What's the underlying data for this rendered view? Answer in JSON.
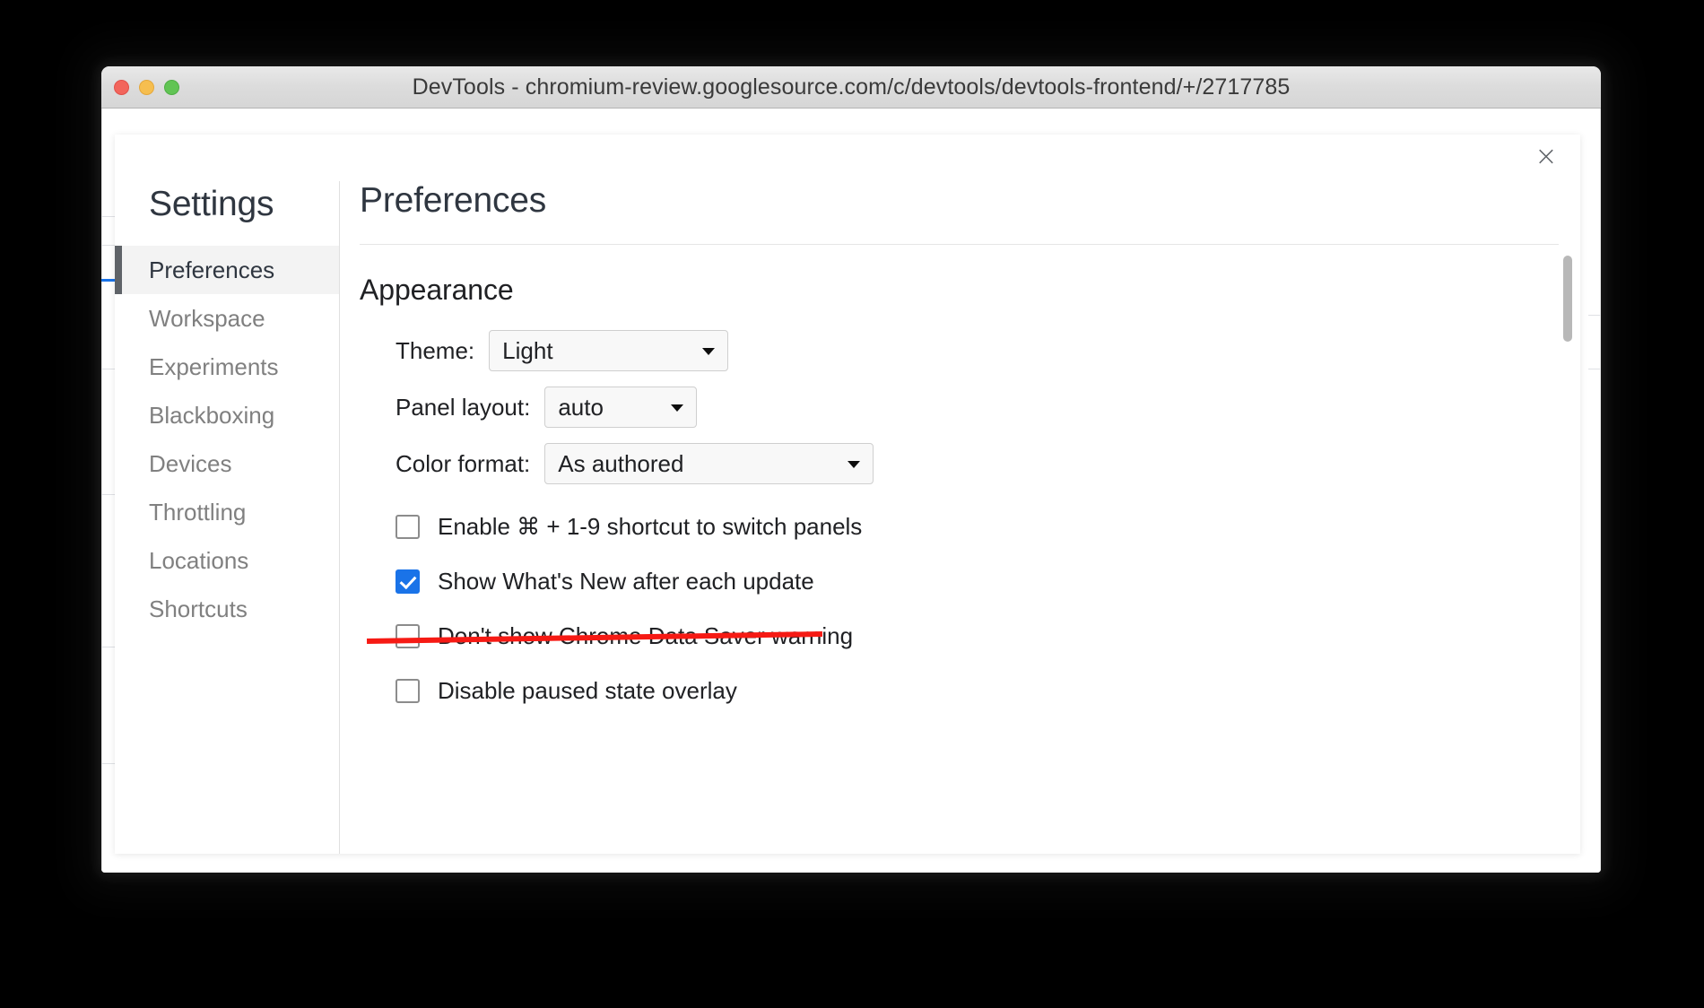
{
  "window": {
    "title": "DevTools - chromium-review.googlesource.com/c/devtools/devtools-frontend/+/2717785",
    "traffic_lights": [
      "close",
      "minimize",
      "zoom"
    ]
  },
  "dialog": {
    "close_label": "×",
    "sidebar": {
      "heading": "Settings",
      "items": [
        {
          "label": "Preferences",
          "selected": true
        },
        {
          "label": "Workspace",
          "selected": false
        },
        {
          "label": "Experiments",
          "selected": false
        },
        {
          "label": "Blackboxing",
          "selected": false
        },
        {
          "label": "Devices",
          "selected": false
        },
        {
          "label": "Throttling",
          "selected": false
        },
        {
          "label": "Locations",
          "selected": false
        },
        {
          "label": "Shortcuts",
          "selected": false
        }
      ]
    },
    "panel": {
      "title": "Preferences",
      "section_title": "Appearance",
      "selects": [
        {
          "label": "Theme:",
          "value": "Light"
        },
        {
          "label": "Panel layout:",
          "value": "auto"
        },
        {
          "label": "Color format:",
          "value": "As authored"
        }
      ],
      "checkboxes": [
        {
          "label": "Enable ⌘ + 1-9 shortcut to switch panels",
          "checked": false,
          "struck": false
        },
        {
          "label": "Show What's New after each update",
          "checked": true,
          "struck": false
        },
        {
          "label": "Don't show Chrome Data Saver warning",
          "checked": false,
          "struck": true
        },
        {
          "label": "Disable paused state overlay",
          "checked": false,
          "struck": false
        }
      ]
    }
  },
  "colors": {
    "accent_blue": "#1a73e8",
    "annotation_red": "#f61a14",
    "selected_sidebar_bar": "#5f6368",
    "selected_sidebar_bg": "#f3f3f3",
    "text_primary": "#202124",
    "text_muted": "#808080"
  }
}
